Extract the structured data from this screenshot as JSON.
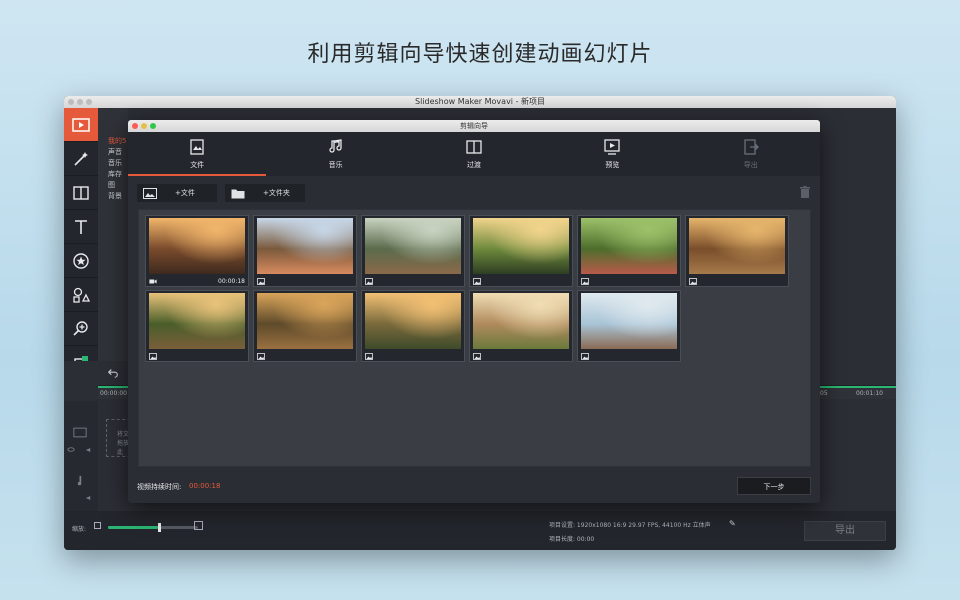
{
  "headline": "利用剪辑向导快速创建动画幻灯片",
  "app": {
    "title": "Slideshow Maker Movavi - 新项目",
    "top_title": "剪辑",
    "left_panel": [
      "我的5",
      "声音",
      "音乐",
      "库存图",
      "背景"
    ],
    "timeline": {
      "ruler_start": "00:00:00",
      "ruler_mid": "05",
      "ruler_end": "00:01:10",
      "drop_hint": "将文件拖放到此"
    },
    "status": {
      "zoom_label": "缩放:",
      "zoom_level": 0.55,
      "project_settings": "项目设置:  1920x1080 16:9 29.97 FPS, 44100 Hz 立体声",
      "project_length": "项目长度:   00:00",
      "export_label": "导出"
    }
  },
  "wizard": {
    "title": "剪辑向导",
    "tabs": [
      {
        "label": "文件",
        "icon": "files-icon",
        "active": true
      },
      {
        "label": "音乐",
        "icon": "music-icon"
      },
      {
        "label": "过渡",
        "icon": "transition-icon"
      },
      {
        "label": "预览",
        "icon": "preview-icon"
      },
      {
        "label": "导出",
        "icon": "export-icon",
        "disabled": true
      }
    ],
    "add_file_label": "+文件",
    "add_folder_label": "+文件夹",
    "items": [
      {
        "type": "video",
        "duration": "00:00:18",
        "palette": [
          "#f1b66b",
          "#7a4b2c",
          "#3e2a1e"
        ]
      },
      {
        "type": "image",
        "palette": [
          "#c7d7e8",
          "#7a5a3c",
          "#d88a5e"
        ]
      },
      {
        "type": "image",
        "palette": [
          "#c9d3c1",
          "#5b6b4c",
          "#8a6a4a"
        ]
      },
      {
        "type": "image",
        "palette": [
          "#f2d48c",
          "#6e8a3c",
          "#2e3e22"
        ]
      },
      {
        "type": "image",
        "palette": [
          "#9dc16a",
          "#4d6e2c",
          "#b85a4a"
        ]
      },
      {
        "type": "image",
        "palette": [
          "#e6b56c",
          "#7a4e2a",
          "#a67a4a"
        ]
      },
      {
        "type": "image",
        "palette": [
          "#e8c27a",
          "#4a5e2a",
          "#7a5e3a"
        ]
      },
      {
        "type": "image",
        "palette": [
          "#d9a45a",
          "#5e4a2a",
          "#9a7040"
        ]
      },
      {
        "type": "image",
        "palette": [
          "#f2c074",
          "#7a6a3c",
          "#3e4a2a"
        ]
      },
      {
        "type": "image",
        "palette": [
          "#f0ddb4",
          "#b08a5c",
          "#6a7a3c"
        ]
      },
      {
        "type": "image",
        "palette": [
          "#dfe9ef",
          "#a8c4d6",
          "#8a6a54"
        ]
      }
    ],
    "duration_label": "视频持续时间:",
    "duration_value": "00:00:18",
    "next_label": "下一步"
  }
}
